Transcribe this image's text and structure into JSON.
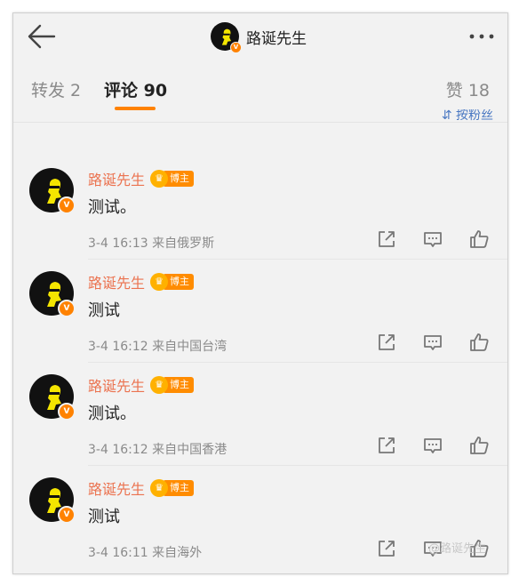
{
  "header": {
    "title": "路诞先生",
    "verified_mark": "V"
  },
  "tabs": {
    "repost": "转发 2",
    "comments": "评论 90",
    "likes": "赞 18"
  },
  "sort_label": "按粉丝",
  "colors": {
    "accent": "#ff8200",
    "name": "#eb7350",
    "sort_link": "#4a78c2"
  },
  "comments": [
    {
      "user": "路诞先生",
      "badge_crown": "♛",
      "badge": "博主",
      "text": "测试。",
      "time_source": "3-4 16:13  来自俄罗斯"
    },
    {
      "user": "路诞先生",
      "badge_crown": "♛",
      "badge": "博主",
      "text": "测试",
      "time_source": "3-4 16:12  来自中国台湾"
    },
    {
      "user": "路诞先生",
      "badge_crown": "♛",
      "badge": "博主",
      "text": "测试。",
      "time_source": "3-4 16:12  来自中国香港"
    },
    {
      "user": "路诞先生",
      "badge_crown": "♛",
      "badge": "博主",
      "text": "测试",
      "time_source": "3-4 16:11  来自海外"
    }
  ],
  "icons": [
    "back-arrow-icon",
    "more-icon",
    "share-icon",
    "comment-icon",
    "like-icon",
    "verified-icon"
  ],
  "watermark": "@路诞先生"
}
